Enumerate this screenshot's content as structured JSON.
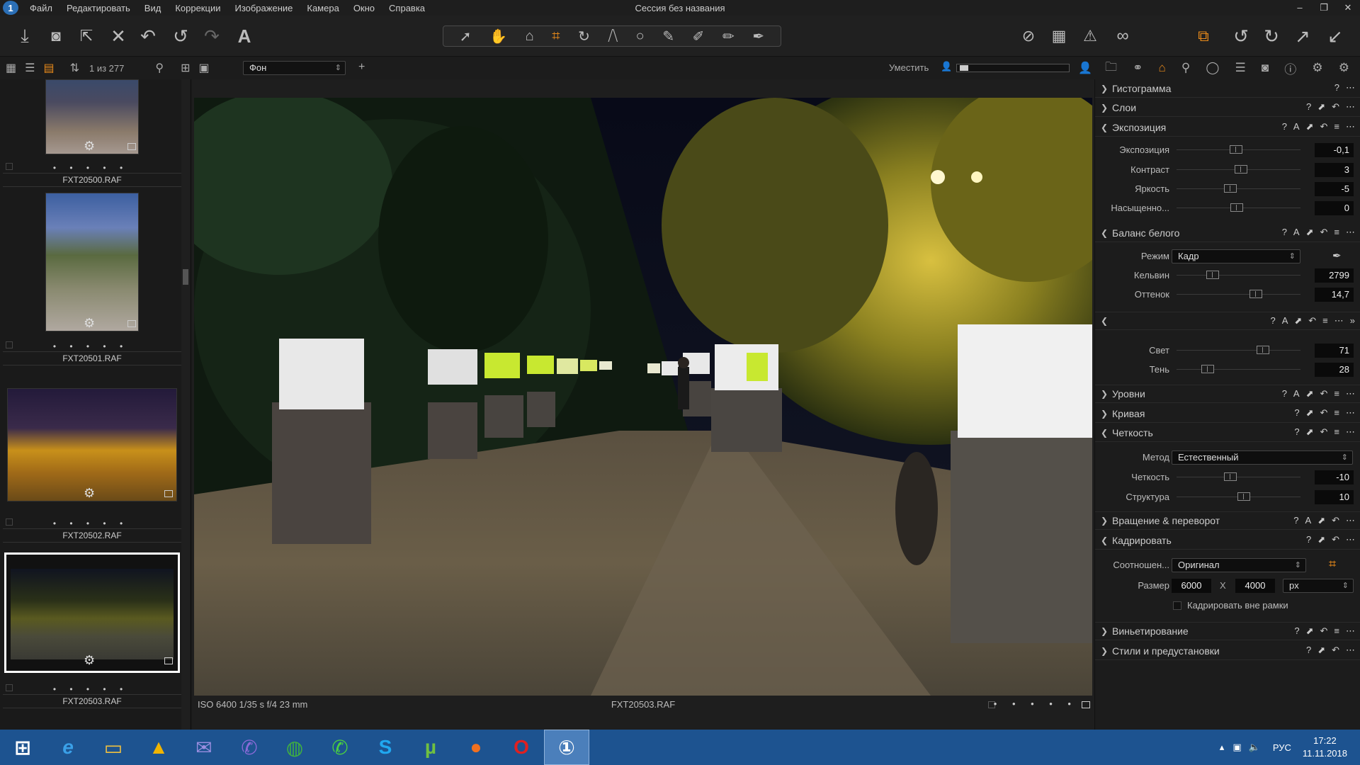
{
  "menubar": {
    "logo": "1",
    "items": [
      "Файл",
      "Редактировать",
      "Вид",
      "Коррекции",
      "Изображение",
      "Камера",
      "Окно",
      "Справка"
    ],
    "window_title": "Сессия без названия",
    "controls": [
      "–",
      "❐",
      "✕"
    ]
  },
  "toolbar": {
    "left_icons": [
      "import-icon",
      "camera-icon",
      "export-icon",
      "delete-icon",
      "undo-icon",
      "rotate-left-icon",
      "redo-icon",
      "text-icon"
    ],
    "cursor_tools": [
      "select-cursor-icon",
      "pan-hand-icon",
      "loupe-icon",
      "crop-icon",
      "rotate-icon",
      "keystone-icon",
      "spot-icon",
      "brush-icon",
      "eraser-icon",
      "gradient-icon",
      "picker-icon"
    ],
    "right_icons": [
      "compare-icon",
      "grid-icon",
      "exposure-warning-icon",
      "proof-icon",
      "copy-icon",
      "undo-adjust-icon",
      "redo-adjust-icon",
      "apply-icon",
      "reset-icon"
    ]
  },
  "subbar": {
    "count": "1 из 277",
    "background_select": "Фон",
    "fit_label": "Уместить"
  },
  "browser": {
    "thumbnails": [
      {
        "filename": "FXT20500.RAF",
        "dots": "• • • • •"
      },
      {
        "filename": "FXT20501.RAF",
        "dots": "• • • • •"
      },
      {
        "filename": "FXT20502.RAF",
        "dots": "• • • • •"
      },
      {
        "filename": "FXT20503.RAF",
        "dots": "• • • • •"
      }
    ]
  },
  "viewer": {
    "meta": "ISO 6400  1/35 s  f/4  23 mm",
    "filename": "FXT20503.RAF",
    "rating_dots": "• • • • •"
  },
  "tools": {
    "histogram": "Гистограмма",
    "layers": "Слои",
    "exposure": {
      "title": "Экспозиция",
      "rows": [
        {
          "label": "Экспозиция",
          "value": "-0,1",
          "pos": 0.43
        },
        {
          "label": "Контраст",
          "value": "3",
          "pos": 0.5
        },
        {
          "label": "Яркость",
          "value": "-5",
          "pos": 0.38
        },
        {
          "label": "Насыщенно...",
          "value": "0",
          "pos": 0.45
        }
      ]
    },
    "white_balance": {
      "title": "Баланс белого",
      "mode_label": "Режим",
      "mode_value": "Кадр",
      "rows": [
        {
          "label": "Кельвин",
          "value": "2799",
          "pos": 0.28
        },
        {
          "label": "Оттенок",
          "value": "14,7",
          "pos": 0.6
        }
      ]
    },
    "highlights": {
      "rows": [
        {
          "label": "Свет",
          "value": "71",
          "pos": 0.64
        },
        {
          "label": "Тень",
          "value": "28",
          "pos": 0.2
        }
      ]
    },
    "levels": "Уровни",
    "curve": "Кривая",
    "clarity": {
      "title": "Четкость",
      "method_label": "Метод",
      "method_value": "Естественный",
      "rows": [
        {
          "label": "Четкость",
          "value": "-10",
          "pos": 0.45
        },
        {
          "label": "Структура",
          "value": "10",
          "pos": 0.55
        }
      ]
    },
    "rotation": "Вращение & переворот",
    "crop": {
      "title": "Кадрировать",
      "ratio_label": "Соотношен...",
      "ratio_value": "Оригинал",
      "size_label": "Размер",
      "width": "6000",
      "x": "X",
      "height": "4000",
      "unit": "px",
      "outside_label": "Кадрировать вне рамки"
    },
    "vignette": "Виньетирование",
    "styles": "Стили и предустановки"
  },
  "taskbar": {
    "lang": "РУС",
    "time": "17:22",
    "date": "11.11.2018"
  },
  "colors": {
    "accent": "#e88a1a",
    "taskbar": "#1d5390"
  }
}
